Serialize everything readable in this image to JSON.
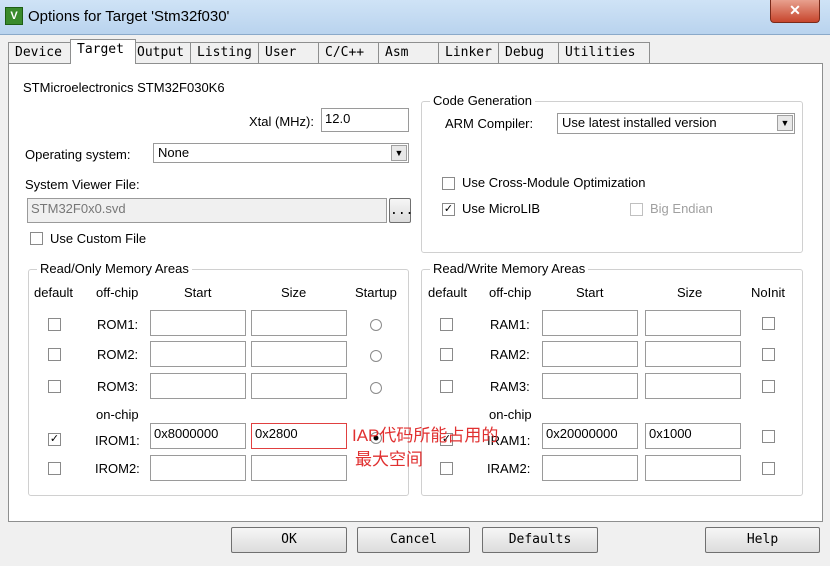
{
  "window": {
    "title": "Options for Target 'Stm32f030'",
    "icon": "V",
    "close": "✕"
  },
  "tabs": [
    "Device",
    "Target",
    "Output",
    "Listing",
    "User",
    "C/C++",
    "Asm",
    "Linker",
    "Debug",
    "Utilities"
  ],
  "device_name": "STMicroelectronics STM32F030K6",
  "xtal": {
    "label": "Xtal (MHz):",
    "value": "12.0"
  },
  "os": {
    "label": "Operating system:",
    "value": "None"
  },
  "svd": {
    "label": "System Viewer File:",
    "value": "STM32F0x0.svd",
    "browse": "..."
  },
  "custom_file": {
    "label": "Use Custom File",
    "checked": false
  },
  "codegen": {
    "title": "Code Generation",
    "compiler_label": "ARM Compiler:",
    "compiler_value": "Use latest installed version",
    "cross_module": {
      "label": "Use Cross-Module Optimization",
      "checked": false
    },
    "microlib": {
      "label": "Use MicroLIB",
      "checked": true
    },
    "big_endian": {
      "label": "Big Endian",
      "checked": false
    }
  },
  "rom": {
    "title": "Read/Only Memory Areas",
    "headers": {
      "default": "default",
      "offchip": "off-chip",
      "start": "Start",
      "size": "Size",
      "startup": "Startup"
    },
    "onchip": "on-chip",
    "rows": [
      {
        "label": "ROM1:",
        "default": false,
        "start": "",
        "size": ""
      },
      {
        "label": "ROM2:",
        "default": false,
        "start": "",
        "size": ""
      },
      {
        "label": "ROM3:",
        "default": false,
        "start": "",
        "size": ""
      },
      {
        "label": "IROM1:",
        "default": true,
        "start": "0x8000000",
        "size": "0x2800"
      },
      {
        "label": "IROM2:",
        "default": false,
        "start": "",
        "size": ""
      }
    ]
  },
  "ram": {
    "title": "Read/Write Memory Areas",
    "headers": {
      "default": "default",
      "offchip": "off-chip",
      "start": "Start",
      "size": "Size",
      "noinit": "NoInit"
    },
    "onchip": "on-chip",
    "rows": [
      {
        "label": "RAM1:",
        "default": false,
        "start": "",
        "size": ""
      },
      {
        "label": "RAM2:",
        "default": false,
        "start": "",
        "size": ""
      },
      {
        "label": "RAM3:",
        "default": false,
        "start": "",
        "size": ""
      },
      {
        "label": "IRAM1:",
        "default": true,
        "start": "0x20000000",
        "size": "0x1000"
      },
      {
        "label": "IRAM2:",
        "default": false,
        "start": "",
        "size": ""
      }
    ]
  },
  "annotation": {
    "line1": "IAP代码所能占用的",
    "line2": "最大空间"
  },
  "buttons": {
    "ok": "OK",
    "cancel": "Cancel",
    "defaults": "Defaults",
    "help": "Help"
  }
}
